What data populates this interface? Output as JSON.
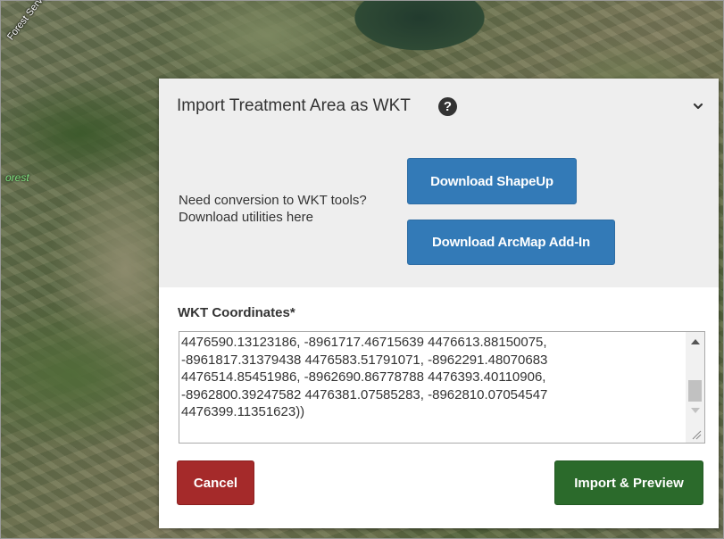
{
  "map": {
    "road_label": "Forest Service Ro",
    "area_label": "orest"
  },
  "panel": {
    "title": "Import Treatment Area as WKT",
    "help_icon": "question-circle-icon",
    "collapse_icon": "chevron-down-icon",
    "hint_line1": "Need conversion to WKT tools?",
    "hint_line2": "Download utilities here",
    "download_shapeup_label": "Download ShapeUp",
    "download_arcmap_label": "Download ArcMap Add-In"
  },
  "wkt": {
    "label": "WKT Coordinates*",
    "value": "4476590.13123186, -8961717.46715639 4476613.88150075,\n-8961817.31379438 4476583.51791071, -8962291.48070683\n4476514.85451986, -8962690.86778788 4476393.40110906,\n-8962800.39247582 4476381.07585283, -8962810.07054547\n4476399.11351623))"
  },
  "actions": {
    "cancel_label": "Cancel",
    "import_label": "Import & Preview"
  },
  "colors": {
    "primary": "#337ab7",
    "danger": "#a52a2a",
    "success": "#2b6a2b",
    "panel_header_bg": "#eeeeee"
  }
}
